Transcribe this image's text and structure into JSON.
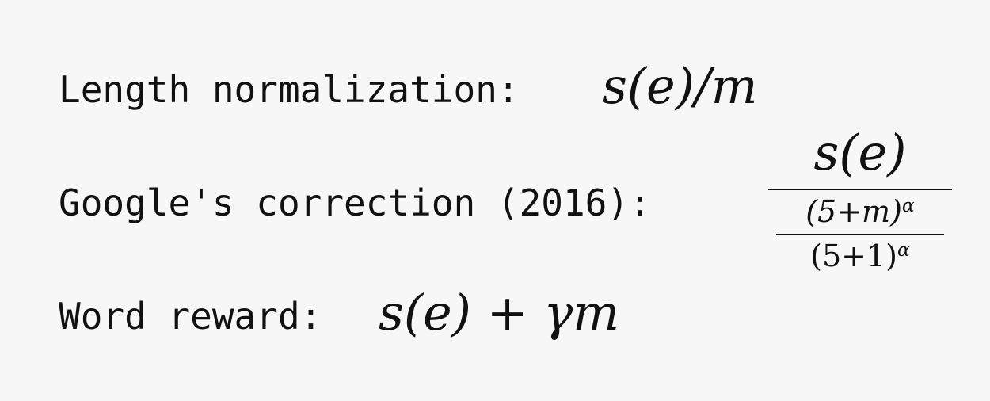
{
  "rows": {
    "length": {
      "label": "Length normalization:",
      "formula": "s(e)/m"
    },
    "google": {
      "label": "Google's correction (2016):",
      "numerator": "s(e)",
      "inner_numerator": "(5+m)",
      "inner_denominator": "(5+1)",
      "exponent": "α"
    },
    "word": {
      "label": "Word reward:",
      "formula": "s(e) + γm"
    }
  }
}
